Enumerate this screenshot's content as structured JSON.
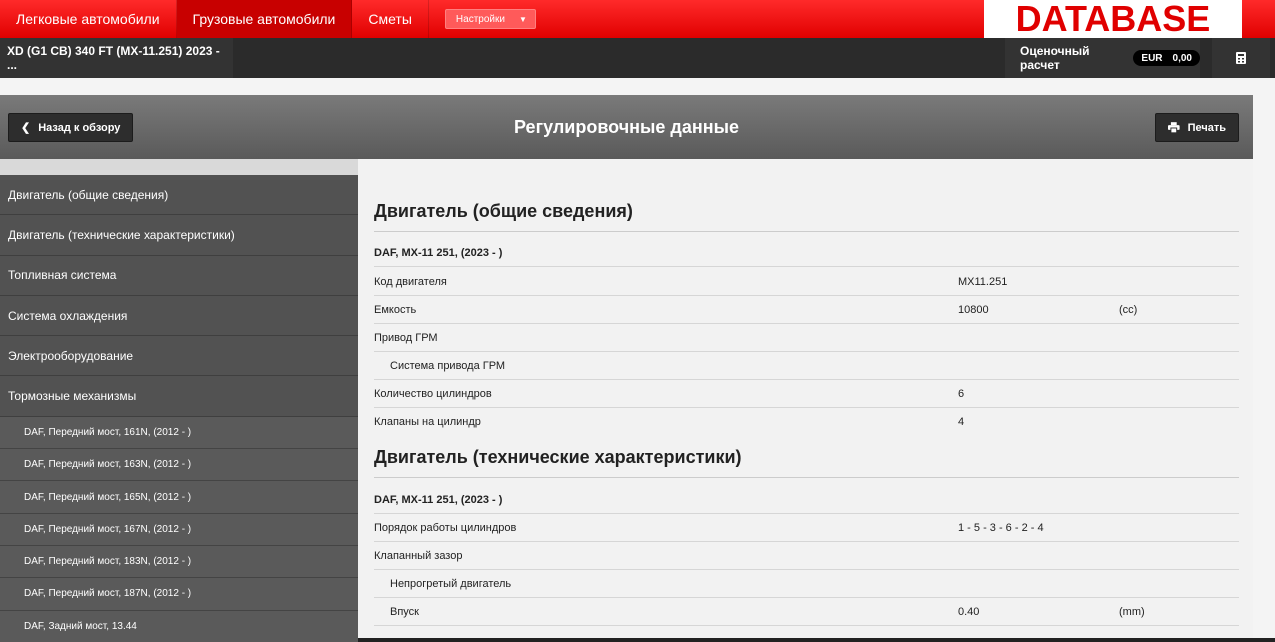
{
  "topnav": {
    "tabs": [
      "Легковые автомобили",
      "Грузовые автомобили",
      "Сметы"
    ],
    "settings_label": "Настройки",
    "logo": "DATABASE"
  },
  "darkbar": {
    "vehicle": "XD (G1 CB) 340 FT (MX-11.251) 2023 - ...",
    "estimate_label": "Оценочный расчет",
    "currency": "EUR",
    "amount": "0,00"
  },
  "header": {
    "back_label": "Назад к обзору",
    "title": "Регулировочные данные",
    "print_label": "Печать"
  },
  "sidebar": {
    "items": [
      "Двигатель (общие сведения)",
      "Двигатель (технические характеристики)",
      "Топливная система",
      "Система охлаждения",
      "Электрооборудование",
      "Тормозные механизмы"
    ],
    "subitems": [
      "DAF, Передний мост, 161N, (2012 - )",
      "DAF, Передний мост, 163N, (2012 - )",
      "DAF, Передний мост, 165N, (2012 - )",
      "DAF, Передний мост, 167N, (2012 - )",
      "DAF, Передний мост, 183N, (2012 - )",
      "DAF, Передний мост, 187N, (2012 - )",
      "DAF, Задний мост, 13.44"
    ]
  },
  "content": {
    "section1": {
      "title": "Двигатель (общие сведения)",
      "subtitle": "DAF, MX-11 251, (2023 - )",
      "rows": [
        {
          "label": "Код двигателя",
          "value": "MX11.251",
          "unit": ""
        },
        {
          "label": "Емкость",
          "value": "10800",
          "unit": "(cc)"
        },
        {
          "label": "Привод ГРМ",
          "value": "",
          "unit": ""
        },
        {
          "label": "Система привода ГРМ",
          "value": "",
          "unit": ""
        },
        {
          "label": "Количество цилиндров",
          "value": "6",
          "unit": ""
        },
        {
          "label": "Клапаны на цилиндр",
          "value": "4",
          "unit": ""
        }
      ]
    },
    "section2": {
      "title": "Двигатель (технические характеристики)",
      "subtitle": "DAF, MX-11 251, (2023 - )",
      "rows": [
        {
          "label": "Порядок работы цилиндров",
          "value": "1 - 5 - 3 - 6 - 2 - 4",
          "unit": ""
        },
        {
          "label": "Клапанный зазор",
          "value": "",
          "unit": ""
        },
        {
          "label": "Непрогретый двигатель",
          "value": "",
          "unit": ""
        },
        {
          "label": "Впуск",
          "value": "0.40",
          "unit": "(mm)"
        }
      ]
    }
  }
}
